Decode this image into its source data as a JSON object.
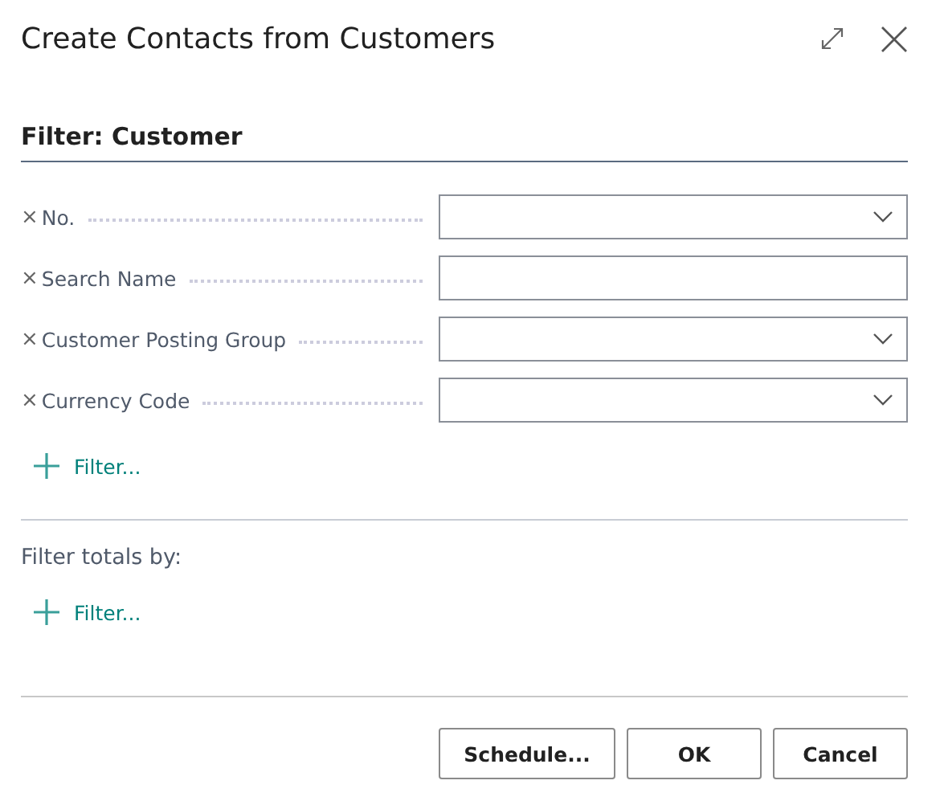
{
  "window": {
    "title": "Create Contacts from Customers"
  },
  "section": {
    "title": "Filter: Customer"
  },
  "filters": [
    {
      "remove": "×",
      "label": "No.",
      "kind": "dropdown"
    },
    {
      "remove": "×",
      "label": "Search Name",
      "kind": "text"
    },
    {
      "remove": "×",
      "label": "Customer Posting Group",
      "kind": "dropdown"
    },
    {
      "remove": "×",
      "label": "Currency Code",
      "kind": "dropdown"
    }
  ],
  "add_filter": {
    "label": "Filter..."
  },
  "totals": {
    "title": "Filter totals by:",
    "add_filter": {
      "label": "Filter..."
    }
  },
  "buttons": [
    "Schedule...",
    "OK",
    "Cancel"
  ]
}
